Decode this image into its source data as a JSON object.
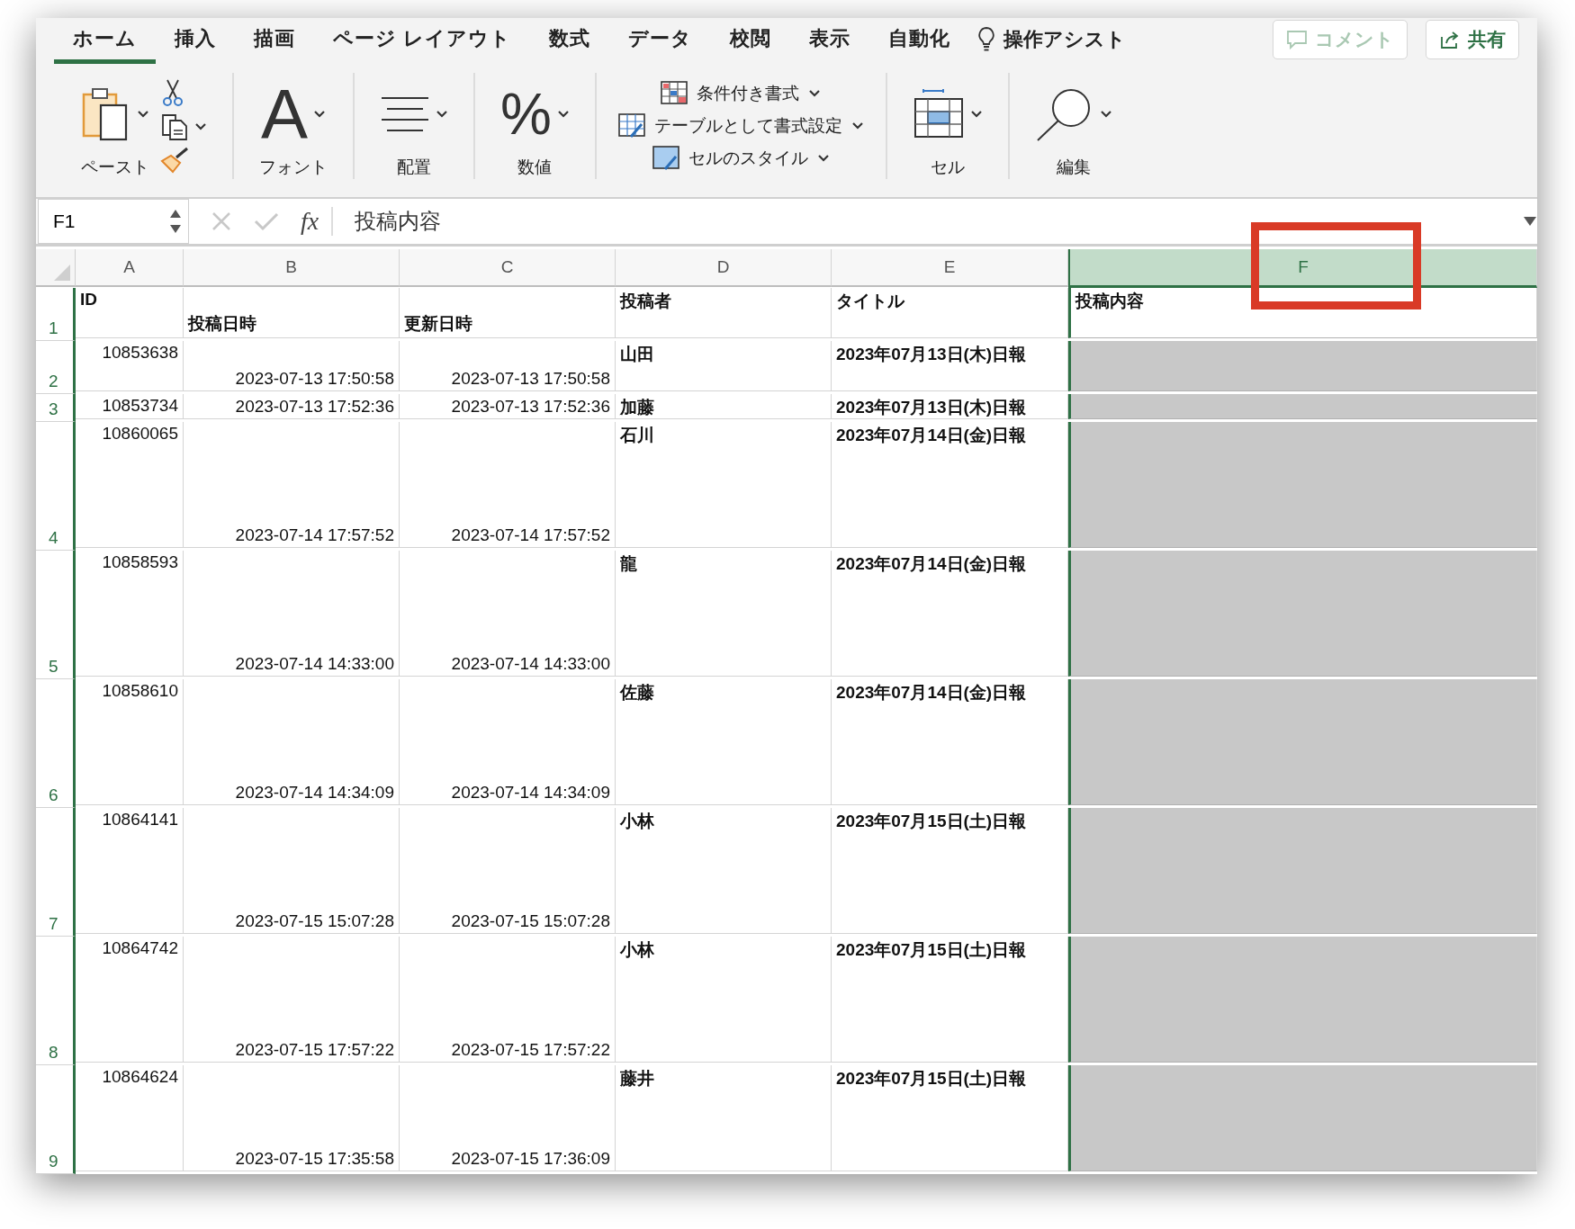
{
  "ribbon": {
    "tabs": [
      {
        "label": "ホーム",
        "selected": true
      },
      {
        "label": "挿入",
        "selected": false
      },
      {
        "label": "描画",
        "selected": false
      },
      {
        "label": "ページ レイアウト",
        "selected": false
      },
      {
        "label": "数式",
        "selected": false
      },
      {
        "label": "データ",
        "selected": false
      },
      {
        "label": "校閲",
        "selected": false
      },
      {
        "label": "表示",
        "selected": false
      },
      {
        "label": "自動化",
        "selected": false
      }
    ],
    "assist": "操作アシスト",
    "buttons": [
      {
        "label": "コメント",
        "kind": "comment",
        "disabled": true
      },
      {
        "label": "共有",
        "kind": "share",
        "disabled": false
      }
    ],
    "groups": [
      {
        "kind": "clipboard",
        "label": "ペースト"
      },
      {
        "kind": "font",
        "glyph": "A",
        "label": "フォント"
      },
      {
        "kind": "align",
        "label": "配置"
      },
      {
        "kind": "number",
        "glyph": "%",
        "label": "数値"
      },
      {
        "kind": "styles",
        "items": [
          "条件付き書式",
          "テーブルとして書式設定",
          "セルのスタイル"
        ]
      },
      {
        "kind": "cells",
        "label": "セル"
      },
      {
        "kind": "edit",
        "label": "編集"
      }
    ]
  },
  "formula_bar": {
    "name_box": "F1",
    "fx": "fx",
    "value": "投稿内容"
  },
  "sheet": {
    "columns": [
      {
        "label": "A",
        "selected": false
      },
      {
        "label": "B",
        "selected": false
      },
      {
        "label": "C",
        "selected": false
      },
      {
        "label": "D",
        "selected": false
      },
      {
        "label": "E",
        "selected": false
      },
      {
        "label": "F",
        "selected": true
      }
    ],
    "rows": [
      {
        "label": "1",
        "kind": "double",
        "active": true,
        "cells": [
          {
            "text": "ID",
            "kind": "text"
          },
          {
            "text": "投稿日時",
            "kind": "caption"
          },
          {
            "text": "更新日時",
            "kind": "caption"
          },
          {
            "text": "投稿者",
            "kind": "text"
          },
          {
            "text": "タイトル",
            "kind": "text"
          },
          {
            "text": "投稿内容",
            "kind": "text"
          }
        ]
      },
      {
        "label": "2",
        "kind": "double",
        "active": false,
        "cells": [
          {
            "text": "10853638",
            "kind": "number"
          },
          {
            "text": "2023-07-13 17:50:58",
            "kind": "date"
          },
          {
            "text": "2023-07-13 17:50:58",
            "kind": "date"
          },
          {
            "text": "山田",
            "kind": "text"
          },
          {
            "text": "2023年07月13日(木)日報",
            "kind": "text"
          }
        ]
      },
      {
        "label": "3",
        "kind": "single",
        "active": false,
        "cells": [
          {
            "text": "10853734",
            "kind": "number"
          },
          {
            "text": "2023-07-13 17:52:36",
            "kind": "date"
          },
          {
            "text": "2023-07-13 17:52:36",
            "kind": "date"
          },
          {
            "text": "加藤",
            "kind": "text"
          },
          {
            "text": "2023年07月13日(木)日報",
            "kind": "text"
          }
        ]
      },
      {
        "label": "4",
        "kind": "tall",
        "active": false,
        "cells": [
          {
            "text": "10860065",
            "kind": "number"
          },
          {
            "text": "2023-07-14 17:57:52",
            "kind": "date"
          },
          {
            "text": "2023-07-14 17:57:52",
            "kind": "date"
          },
          {
            "text": "石川",
            "kind": "text"
          },
          {
            "text": "2023年07月14日(金)日報",
            "kind": "text"
          }
        ]
      },
      {
        "label": "5",
        "kind": "tall",
        "active": false,
        "cells": [
          {
            "text": "10858593",
            "kind": "number"
          },
          {
            "text": "2023-07-14 14:33:00",
            "kind": "date"
          },
          {
            "text": "2023-07-14 14:33:00",
            "kind": "date"
          },
          {
            "text": "龍",
            "kind": "text"
          },
          {
            "text": "2023年07月14日(金)日報",
            "kind": "text"
          }
        ]
      },
      {
        "label": "6",
        "kind": "tall",
        "active": false,
        "cells": [
          {
            "text": "10858610",
            "kind": "number"
          },
          {
            "text": "2023-07-14 14:34:09",
            "kind": "date"
          },
          {
            "text": "2023-07-14 14:34:09",
            "kind": "date"
          },
          {
            "text": "佐藤",
            "kind": "text"
          },
          {
            "text": "2023年07月14日(金)日報",
            "kind": "text"
          }
        ]
      },
      {
        "label": "7",
        "kind": "tall",
        "active": false,
        "cells": [
          {
            "text": "10864141",
            "kind": "number"
          },
          {
            "text": "2023-07-15 15:07:28",
            "kind": "date"
          },
          {
            "text": "2023-07-15 15:07:28",
            "kind": "date"
          },
          {
            "text": "小林",
            "kind": "text"
          },
          {
            "text": "2023年07月15日(土)日報",
            "kind": "text"
          }
        ]
      },
      {
        "label": "8",
        "kind": "tall",
        "active": false,
        "cells": [
          {
            "text": "10864742",
            "kind": "number"
          },
          {
            "text": "2023-07-15 17:57:22",
            "kind": "date"
          },
          {
            "text": "2023-07-15 17:57:22",
            "kind": "date"
          },
          {
            "text": "小林",
            "kind": "text"
          },
          {
            "text": "2023年07月15日(土)日報",
            "kind": "text"
          }
        ]
      },
      {
        "label": "9",
        "kind": "last",
        "active": false,
        "cells": [
          {
            "text": "10864624",
            "kind": "number"
          },
          {
            "text": "2023-07-15 17:35:58",
            "kind": "date"
          },
          {
            "text": "2023-07-15 17:36:09",
            "kind": "date"
          },
          {
            "text": "藤井",
            "kind": "text"
          },
          {
            "text": "2023年07月15日(土)日報",
            "kind": "text"
          }
        ]
      }
    ],
    "callout": {
      "kind": "rectangle"
    }
  }
}
